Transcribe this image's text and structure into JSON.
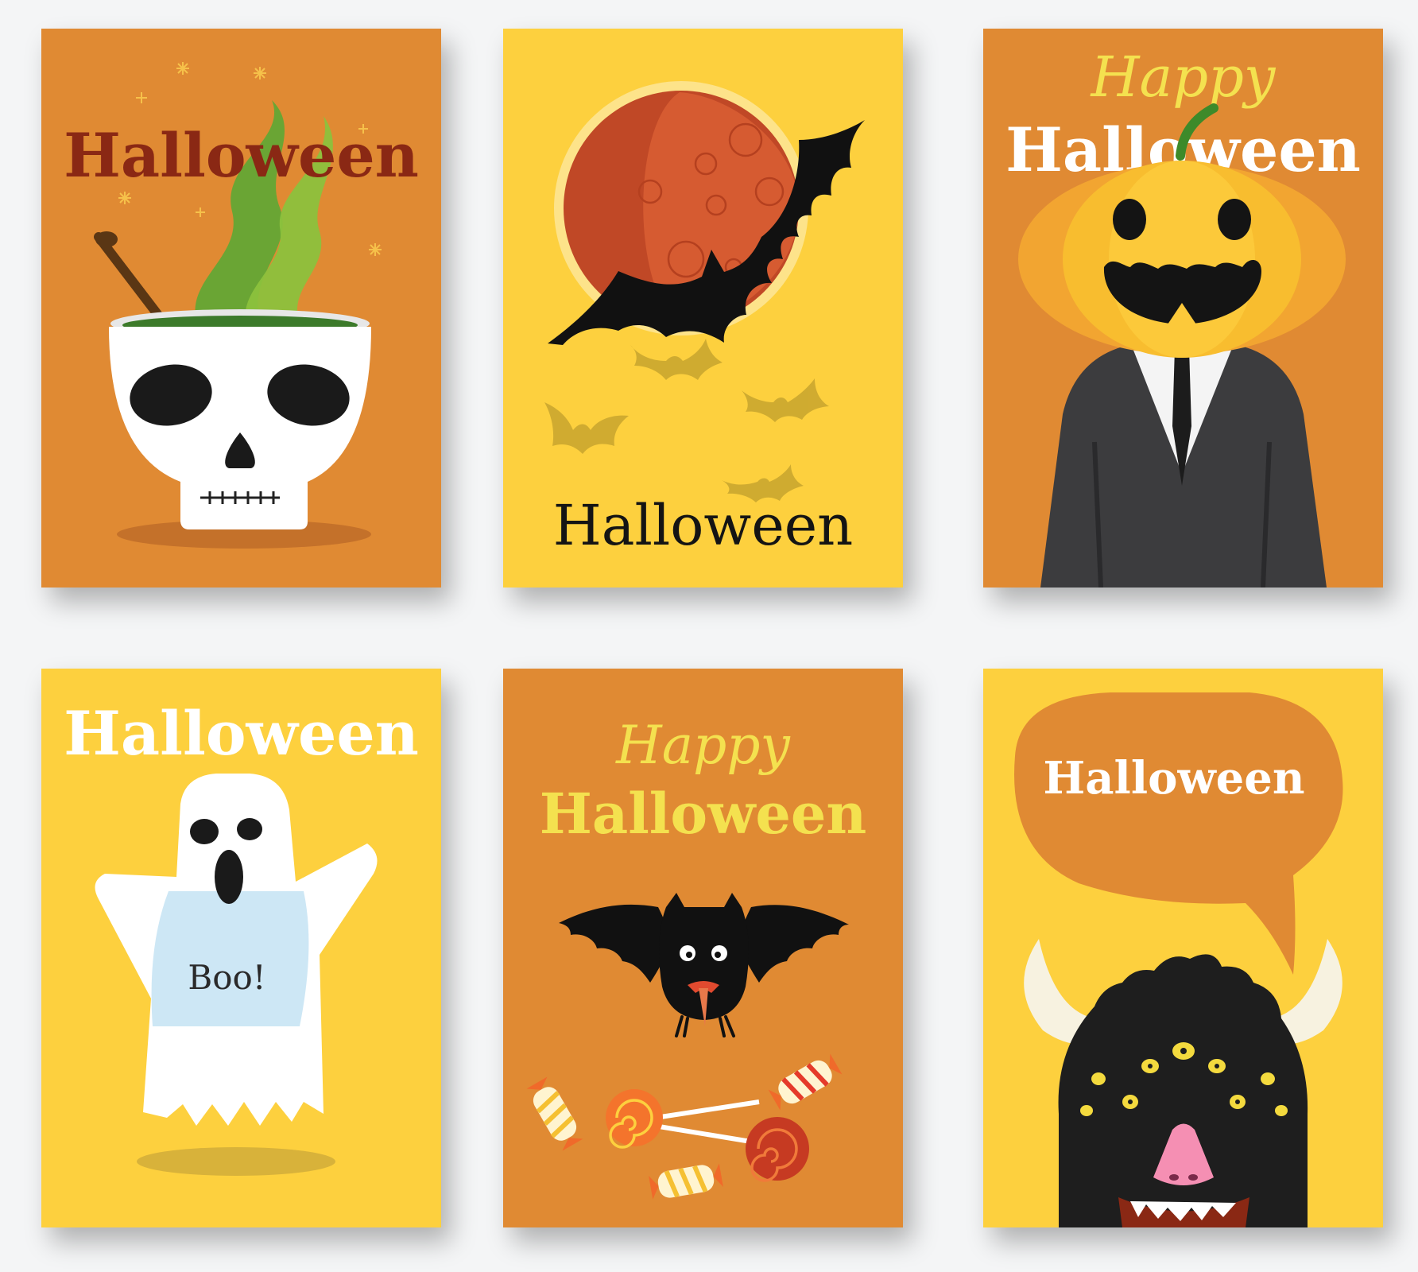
{
  "colors": {
    "orange": "#e08a33",
    "yellow": "#fdd03e",
    "dark_red": "#8a2814",
    "black": "#141414",
    "white": "#ffffff",
    "pale_yellow": "#f4e14f"
  },
  "cards": [
    {
      "title": "Halloween",
      "illustration": "skull-cauldron-icon"
    },
    {
      "title": "Halloween",
      "illustration": "moon-bat-icon"
    },
    {
      "subtitle": "Happy",
      "title": "Halloween",
      "illustration": "pumpkin-head-suit-icon"
    },
    {
      "title": "Halloween",
      "shirt_text": "Boo!",
      "illustration": "ghost-icon"
    },
    {
      "subtitle": "Happy",
      "title": "Halloween",
      "illustration": "bat-candy-icon"
    },
    {
      "title": "Halloween",
      "illustration": "horned-monster-icon"
    }
  ]
}
